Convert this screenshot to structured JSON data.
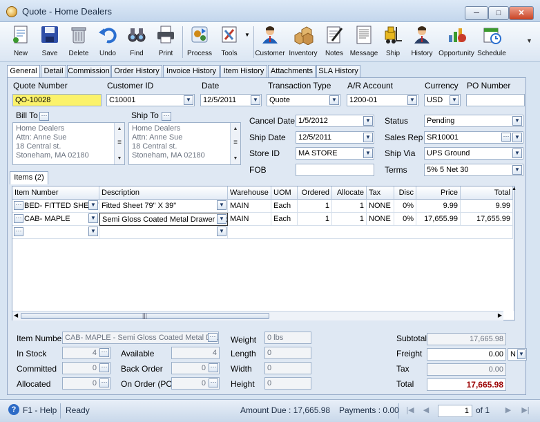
{
  "window": {
    "title": "Quote - Home Dealers",
    "minimize": "─",
    "maximize": "□",
    "close": "✕"
  },
  "toolbar": {
    "items": [
      {
        "label": "New",
        "icon": "new-document-icon"
      },
      {
        "label": "Save",
        "icon": "floppy-disk-icon"
      },
      {
        "label": "Delete",
        "icon": "trash-can-icon"
      },
      {
        "label": "Undo",
        "icon": "undo-arrow-icon"
      },
      {
        "label": "Find",
        "icon": "binoculars-icon"
      },
      {
        "label": "Print",
        "icon": "printer-icon"
      },
      {
        "label": "Process",
        "icon": "process-gears-icon"
      },
      {
        "label": "Tools",
        "icon": "tools-icon"
      },
      {
        "label": "Customer",
        "icon": "customer-person-icon"
      },
      {
        "label": "Inventory",
        "icon": "inventory-boxes-icon"
      },
      {
        "label": "Notes",
        "icon": "notes-pen-icon"
      },
      {
        "label": "Message",
        "icon": "message-document-icon"
      },
      {
        "label": "Ship",
        "icon": "forklift-icon"
      },
      {
        "label": "History",
        "icon": "history-person-icon"
      },
      {
        "label": "Opportunity",
        "icon": "opportunity-chart-icon"
      },
      {
        "label": "Schedule",
        "icon": "schedule-calendar-icon"
      }
    ]
  },
  "tabs": [
    "General",
    "Detail",
    "Commission",
    "Order History",
    "Invoice History",
    "Item History",
    "Attachments",
    "SLA History"
  ],
  "header": {
    "quote_number_label": "Quote Number",
    "quote_number": "QO-10028",
    "customer_id_label": "Customer ID",
    "customer_id": "C10001",
    "date_label": "Date",
    "date": "12/5/2011",
    "transaction_type_label": "Transaction Type",
    "transaction_type": "Quote",
    "ar_account_label": "A/R Account",
    "ar_account": "1200-01",
    "currency_label": "Currency",
    "currency": "USD",
    "po_number_label": "PO Number",
    "po_number": ""
  },
  "bill_to": {
    "label": "Bill To",
    "lines": [
      "Home Dealers",
      "Attn: Anne Sue",
      "18 Central st.",
      "Stoneham, MA 02180"
    ]
  },
  "ship_to": {
    "label": "Ship To",
    "lines": [
      "Home Dealers",
      "Attn: Anne Sue",
      "18 Central st.",
      "Stoneham, MA 02180"
    ]
  },
  "order": {
    "cancel_date_label": "Cancel  Date",
    "cancel_date": "1/5/2012",
    "ship_date_label": "Ship Date",
    "ship_date": "12/5/2011",
    "store_id_label": "Store ID",
    "store_id": "MA STORE",
    "fob_label": "FOB",
    "fob": "",
    "status_label": "Status",
    "status": "Pending",
    "sales_rep_label": "Sales Rep",
    "sales_rep": "SR10001",
    "ship_via_label": "Ship Via",
    "ship_via": "UPS Ground",
    "terms_label": "Terms",
    "terms": "5% 5 Net 30"
  },
  "items": {
    "tab_label": "Items (2)",
    "columns": [
      "Item Number",
      "Description",
      "Warehouse",
      "UOM",
      "Ordered",
      "Allocate",
      "Tax",
      "Disc",
      "Price",
      "Total"
    ],
    "rows": [
      {
        "item": "BED- FITTED SHEET",
        "desc": "Fitted Sheet 79\" X 39\"",
        "warehouse": "MAIN",
        "uom": "Each",
        "ordered": "1",
        "allocate": "1",
        "tax": "NONE",
        "disc": "0%",
        "price": "9.99",
        "total": "9.99"
      },
      {
        "item": "CAB- MAPLE",
        "desc": "Semi Gloss Coated Metal Drawer Slides",
        "warehouse": "MAIN",
        "uom": "Each",
        "ordered": "1",
        "allocate": "1",
        "tax": "NONE",
        "disc": "0%",
        "price": "17,655.99",
        "total": "17,655.99"
      }
    ]
  },
  "detail": {
    "item_number_label": "Item Number",
    "item_number": "CAB- MAPLE - Semi Gloss Coated Metal Drawer Slides",
    "in_stock_label": "In Stock",
    "in_stock": "4",
    "available_label": "Available",
    "available": "4",
    "committed_label": "Committed",
    "committed": "0",
    "back_order_label": "Back Order",
    "back_order": "0",
    "allocated_label": "Allocated",
    "allocated": "0",
    "on_order_label": "On Order (PO)",
    "on_order": "0",
    "weight_label": "Weight",
    "weight": "0 lbs",
    "length_label": "Length",
    "length": "0",
    "width_label": "Width",
    "width": "0",
    "height_label": "Height",
    "height": "0"
  },
  "totals": {
    "subtotal_label": "Subtotal",
    "subtotal": "17,665.98",
    "freight_label": "Freight",
    "freight": "0.00",
    "freight_code": "N",
    "tax_label": "Tax",
    "tax": "0.00",
    "total_label": "Total",
    "total": "17,665.98"
  },
  "status": {
    "help": "F1 - Help",
    "state": "Ready",
    "amount_due": "Amount Due : 17,665.98",
    "payments": "Payments : 0.00",
    "page": "1",
    "of_pages": "of  1"
  },
  "colors": {
    "accent": "#fbf26a",
    "total_red": "#9b0000",
    "header_blue": "#dfe8f3"
  }
}
